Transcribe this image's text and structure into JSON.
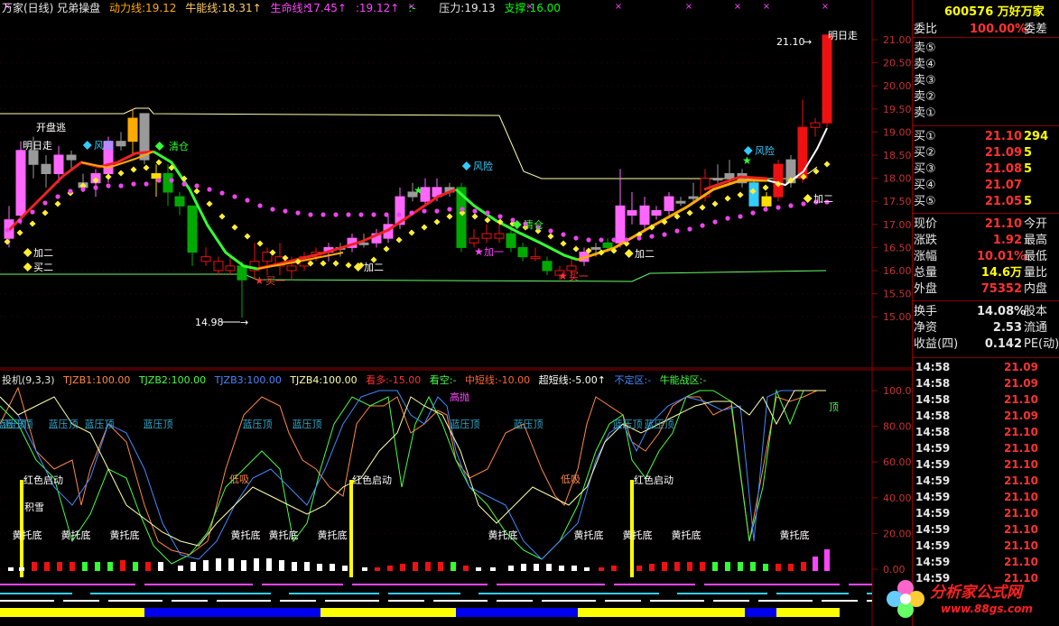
{
  "header": {
    "title": "万家(日线) 兄弟操盘",
    "items": [
      {
        "text": "动力线:19.12",
        "color": "#ffaa00"
      },
      {
        "text": "牛能线:18.31↑",
        "color": "#ffcc66"
      },
      {
        "text": "生命线:17.45↑",
        "color": "#ff44ff"
      },
      {
        "text": ":19.12↑",
        "color": "#ff44ff"
      },
      {
        "text": ":-",
        "color": "#00ff00"
      },
      {
        "text": "压力:19.13",
        "color": "#e6e6e6"
      },
      {
        "text": "支撑:16.00",
        "color": "#00ff00"
      }
    ]
  },
  "sub_header": {
    "title": "投机(9,3,3)",
    "items": [
      {
        "text": "TJZB1:100.00",
        "color": "#ff8844"
      },
      {
        "text": "TJZB2:100.00",
        "color": "#44ff44"
      },
      {
        "text": "TJZB3:100.00",
        "color": "#4488ff"
      },
      {
        "text": "TJZB4:100.00",
        "color": "#ffffaa"
      },
      {
        "text": "看多:-15.00",
        "color": "#ff3333"
      },
      {
        "text": "看空:-",
        "color": "#44ff44"
      },
      {
        "text": "中短线:-10.00",
        "color": "#ff6633"
      },
      {
        "text": "超短线:-5.00↑",
        "color": "#ffffff"
      },
      {
        "text": "不定区:-",
        "color": "#4488ff"
      },
      {
        "text": "牛能战区:-",
        "color": "#44ff44"
      }
    ]
  },
  "price_axis": [
    "21.00",
    "20.50",
    "20.00",
    "19.50",
    "19.00",
    "18.50",
    "18.00",
    "17.50",
    "17.00",
    "16.50",
    "16.00",
    "15.50",
    "15.00"
  ],
  "ind_axis": [
    "100.00",
    "80.00",
    "60.00",
    "40.00",
    "20.00",
    "0.00"
  ],
  "chart_labels": {
    "open_escape": "开盘逃",
    "tomorrow_walk": "明日走",
    "risk": "风险",
    "clear": "清仓",
    "add_two": "加二",
    "buy_two": "买二",
    "buy_one": "买一",
    "add_one": "加一",
    "low_price": "14.98",
    "high_price": "21.10",
    "high_mark": "明日走",
    "red_start": "红色启动",
    "yellow_bottom": "黄托底",
    "blue_top": "蓝压顶",
    "low_buy": "低吸",
    "high_throw": "高抛",
    "top": "顶",
    "snow": "积雪"
  },
  "quote": {
    "title": "600576 万好万家",
    "rows": [
      {
        "label": "委比",
        "v1": "100.00%",
        "v1_color": "#ff3232",
        "v2": "委差"
      },
      {
        "label": "卖⑤",
        "v1": "",
        "v1_color": "#ff3232",
        "v2": ""
      },
      {
        "label": "卖④",
        "v1": "",
        "v1_color": "#ff3232",
        "v2": ""
      },
      {
        "label": "卖③",
        "v1": "",
        "v1_color": "#ff3232",
        "v2": ""
      },
      {
        "label": "卖②",
        "v1": "",
        "v1_color": "#ff3232",
        "v2": ""
      },
      {
        "label": "卖①",
        "v1": "",
        "v1_color": "#ff3232",
        "v2": ""
      },
      {
        "label": "买①",
        "v1": "21.10",
        "v1_color": "#ff3232",
        "v2": "294",
        "v2_color": "#ffff00"
      },
      {
        "label": "买②",
        "v1": "21.09",
        "v1_color": "#ff3232",
        "v2": "5",
        "v2_color": "#ffff00"
      },
      {
        "label": "买③",
        "v1": "21.08",
        "v1_color": "#ff3232",
        "v2": "5",
        "v2_color": "#ffff00"
      },
      {
        "label": "买④",
        "v1": "21.07",
        "v1_color": "#ff3232",
        "v2": ""
      },
      {
        "label": "买⑤",
        "v1": "21.05",
        "v1_color": "#ff3232",
        "v2": "5",
        "v2_color": "#ffff00"
      },
      {
        "label": "现价",
        "v1": "21.10",
        "v1_color": "#ff3232",
        "v2": "今开"
      },
      {
        "label": "涨跌",
        "v1": "1.92",
        "v1_color": "#ff3232",
        "v2": "最高"
      },
      {
        "label": "涨幅",
        "v1": "10.01%",
        "v1_color": "#ff3232",
        "v2": "最低"
      },
      {
        "label": "总量",
        "v1": "14.6万",
        "v1_color": "#ffff00",
        "v2": "量比"
      },
      {
        "label": "外盘",
        "v1": "75352",
        "v1_color": "#ff3232",
        "v2": "内盘"
      },
      {
        "label": "换手",
        "v1": "14.08%",
        "v1_color": "#e6e6e6",
        "v2": "股本"
      },
      {
        "label": "净资",
        "v1": "2.53",
        "v1_color": "#e6e6e6",
        "v2": "流通"
      },
      {
        "label": "收益(四)",
        "v1": "0.142",
        "v1_color": "#e6e6e6",
        "v2": "PE(动)"
      }
    ],
    "ticks": [
      {
        "t": "14:58",
        "p": "21.09"
      },
      {
        "t": "14:58",
        "p": "21.09"
      },
      {
        "t": "14:58",
        "p": "21.10"
      },
      {
        "t": "14:58",
        "p": "21.09"
      },
      {
        "t": "14:58",
        "p": "21.10"
      },
      {
        "t": "14:59",
        "p": "21.10"
      },
      {
        "t": "14:59",
        "p": "21.10"
      },
      {
        "t": "14:59",
        "p": "21.10"
      },
      {
        "t": "14:59",
        "p": "21.10"
      },
      {
        "t": "14:59",
        "p": "21.10"
      },
      {
        "t": "14:59",
        "p": "21.10"
      },
      {
        "t": "14:59",
        "p": "21.10"
      },
      {
        "t": "14:59",
        "p": "21.10"
      },
      {
        "t": "14:59",
        "p": "21.10"
      }
    ]
  },
  "logo": {
    "line1": "分析家公式网",
    "line2": "www.88gs.com"
  }
}
